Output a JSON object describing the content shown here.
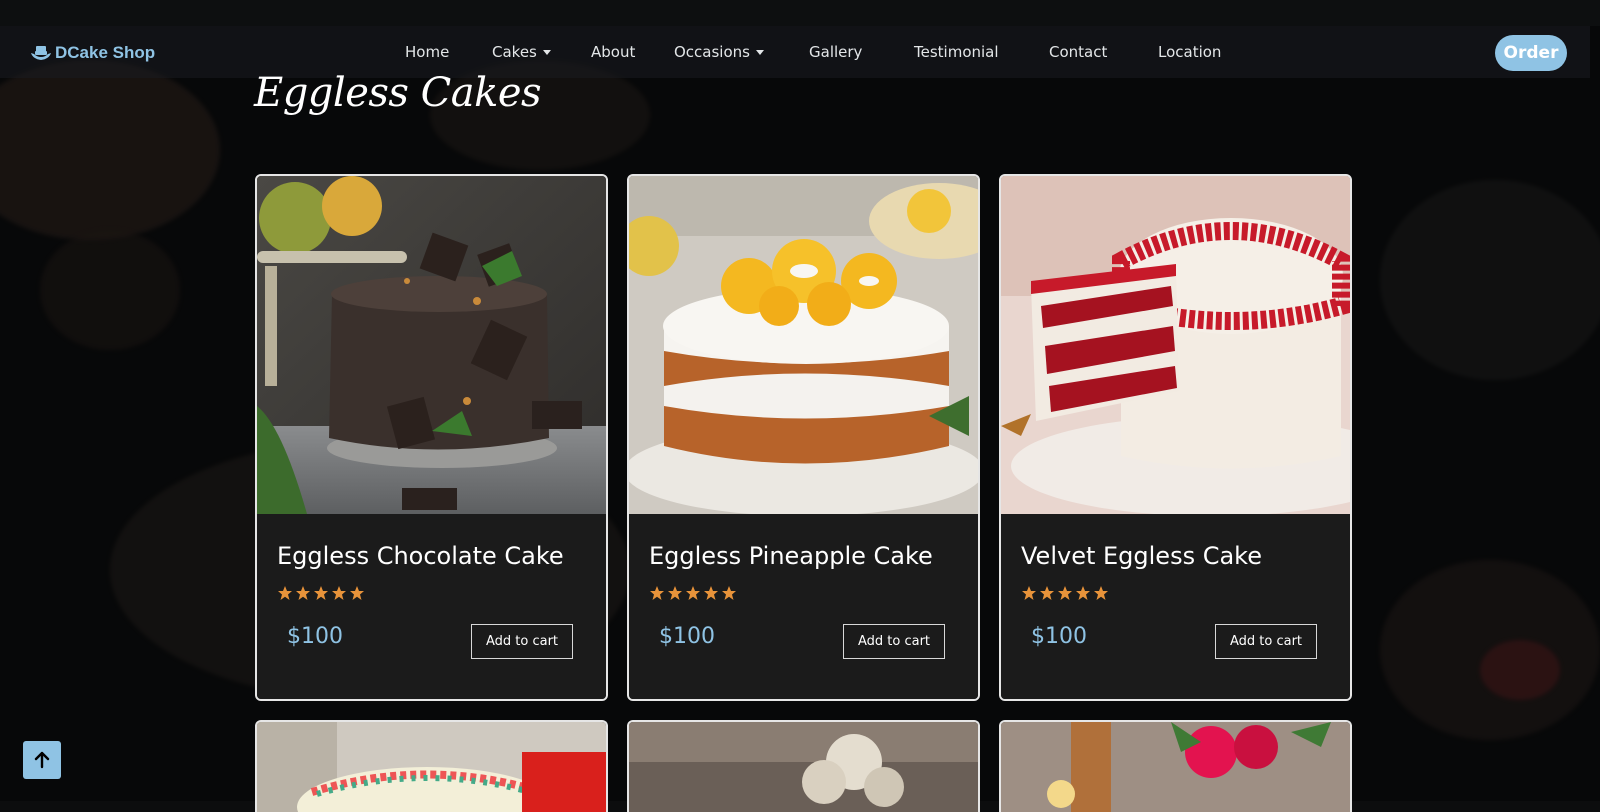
{
  "brand": {
    "name": "DCake Shop",
    "icon": "cake-hands-icon",
    "color": "#8fc3e4"
  },
  "nav": {
    "items": [
      {
        "label": "Home"
      },
      {
        "label": "Cakes",
        "dropdown": true
      },
      {
        "label": "About"
      },
      {
        "label": "Occasions",
        "dropdown": true
      },
      {
        "label": "Gallery"
      },
      {
        "label": "Testimonial"
      },
      {
        "label": "Contact"
      },
      {
        "label": "Location"
      }
    ],
    "order_label": "Order"
  },
  "page": {
    "title": "Eggless Cakes"
  },
  "products": [
    {
      "name": "Eggless Chocolate Cake",
      "rating": 5,
      "price": "$100",
      "cart_label": "Add to cart",
      "image": "chocolate-cake-photo"
    },
    {
      "name": "Eggless Pineapple Cake",
      "rating": 5,
      "price": "$100",
      "cart_label": "Add to cart",
      "image": "pineapple-cake-photo"
    },
    {
      "name": "Velvet Eggless Cake",
      "rating": 5,
      "price": "$100",
      "cart_label": "Add to cart",
      "image": "red-velvet-cake-photo"
    }
  ],
  "products_row2": [
    {
      "image": "sprinkle-cake-photo"
    },
    {
      "image": "flower-cake-photo"
    },
    {
      "image": "rose-vase-photo"
    }
  ],
  "colors": {
    "accent": "#8fc3e4",
    "star": "#e8933a",
    "card_bg": "#1b1b1b"
  },
  "back_to_top": {
    "icon": "arrow-up-icon"
  }
}
